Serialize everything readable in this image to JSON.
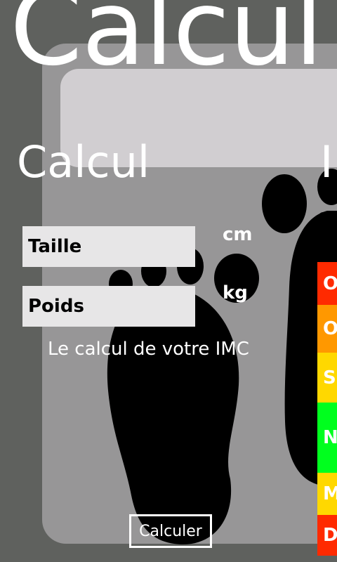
{
  "app": {
    "title": "Calcul"
  },
  "pivot": {
    "active_header": "Calcul",
    "next_header": "I"
  },
  "form": {
    "height_placeholder": "Taille",
    "height_unit": "cm",
    "weight_placeholder": "Poids",
    "weight_unit": "kg",
    "result_text": "Le calcul de votre IMC",
    "calculate_label": "Calculer"
  },
  "legend": [
    {
      "letter": "O",
      "color": "#ff2a00"
    },
    {
      "letter": "O",
      "color": "#ff9800"
    },
    {
      "letter": "S",
      "color": "#ffd800"
    },
    {
      "letter": "N",
      "color": "#00ff1e"
    },
    {
      "letter": "M",
      "color": "#ffd800"
    },
    {
      "letter": "D",
      "color": "#ff2a00"
    }
  ],
  "colors": {
    "page_background": "#5f615e",
    "scale_body": "#979697",
    "scale_display": "#d1ced1",
    "foot": "#000000",
    "text": "#ffffff"
  }
}
